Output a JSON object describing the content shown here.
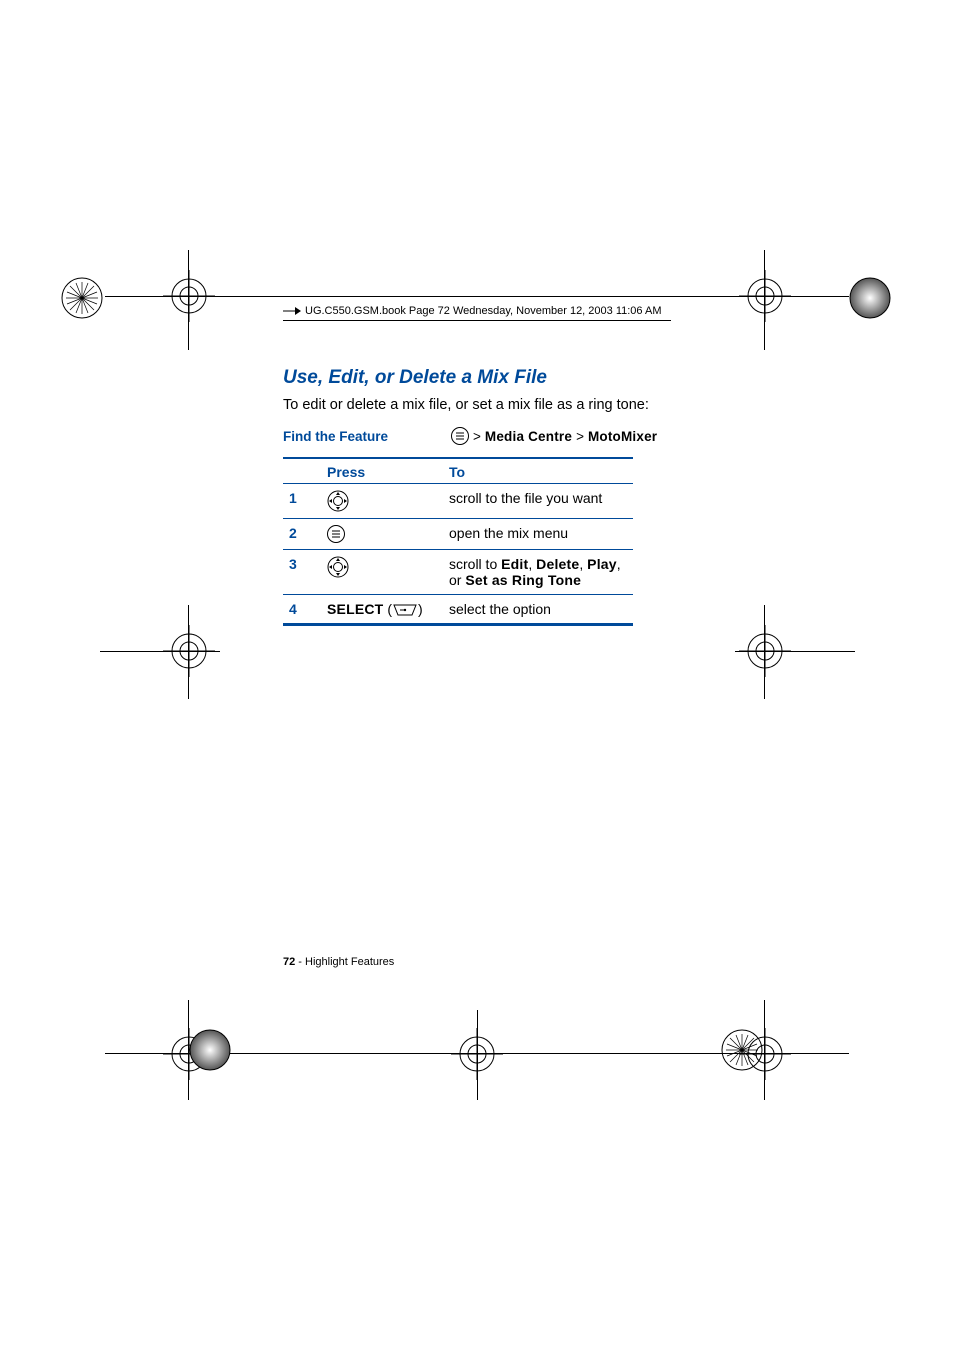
{
  "header": {
    "file_info": "UG.C550.GSM.book  Page 72  Wednesday, November 12, 2003  11:06 AM"
  },
  "section": {
    "title": "Use, Edit, or Delete a Mix File",
    "intro": "To edit or delete a mix file, or set a mix file as a ring tone:"
  },
  "find_feature": {
    "label": "Find the Feature",
    "sep": ">",
    "item1": "Media Centre",
    "item2": "MotoMixer"
  },
  "table": {
    "head_press": "Press",
    "head_to": "To",
    "rows": [
      {
        "n": "1",
        "press_icon": "nav",
        "to_plain": "scroll to the file you want"
      },
      {
        "n": "2",
        "press_icon": "menu",
        "to_plain": "open the mix menu"
      },
      {
        "n": "3",
        "press_icon": "nav",
        "to_pre": "scroll to ",
        "to_b1": "Edit",
        "to_c1": ", ",
        "to_b2": "Delete",
        "to_c2": ", ",
        "to_b3": "Play",
        "to_c3": ", or ",
        "to_b4": "Set as Ring Tone"
      },
      {
        "n": "4",
        "press_label": "SELECT",
        "press_paren_open": "(",
        "press_paren_close": ")",
        "press_icon": "softkey",
        "to_plain": "select the option"
      }
    ]
  },
  "footer": {
    "page_num": "72",
    "sep": " - ",
    "section": "Highlight Features"
  }
}
